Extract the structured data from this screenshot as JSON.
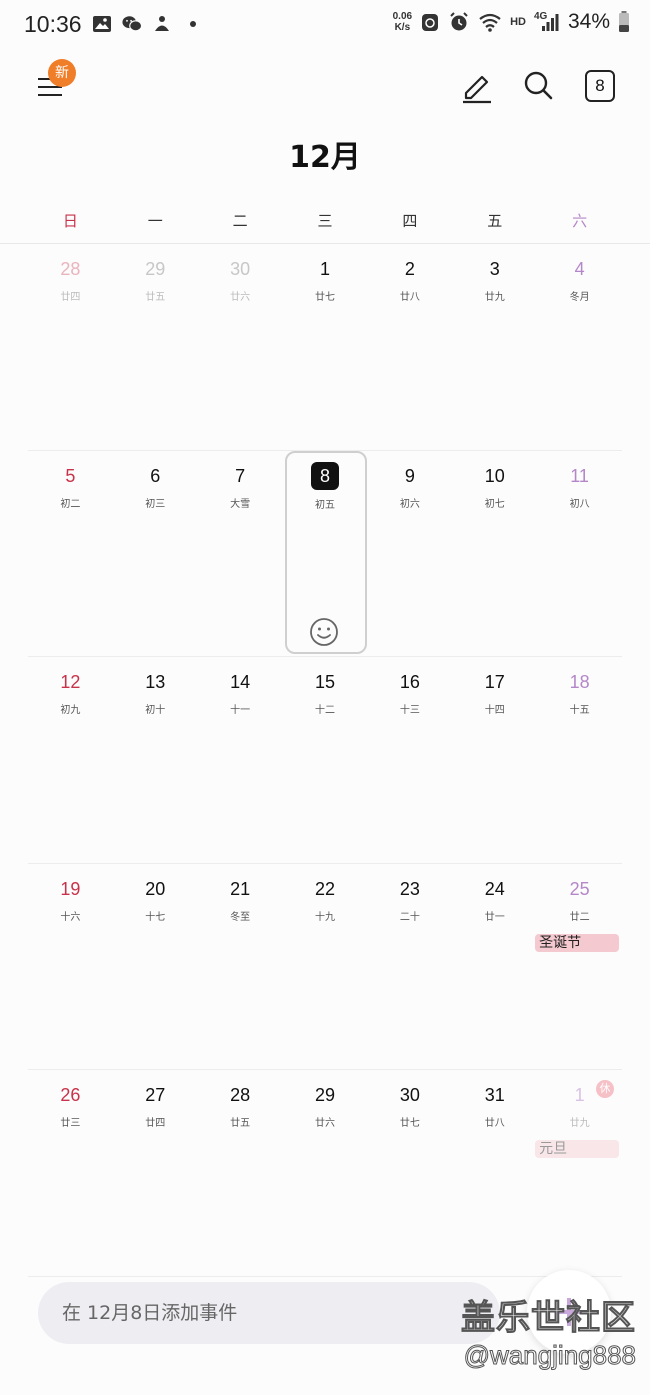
{
  "status_bar": {
    "time": "10:36",
    "net_speed_value": "0.06",
    "net_speed_unit": "K/s",
    "hd": "HD",
    "signal_type": "4G",
    "battery": "34%"
  },
  "toolbar": {
    "new_badge": "新",
    "today_number": "8",
    "icons": [
      "menu-icon",
      "pen-icon",
      "search-icon",
      "today-icon"
    ]
  },
  "month_title": "12月",
  "weekdays": [
    "日",
    "一",
    "二",
    "三",
    "四",
    "五",
    "六"
  ],
  "weeks": [
    [
      {
        "day": "28",
        "lunar": "廿四",
        "other": true
      },
      {
        "day": "29",
        "lunar": "廿五",
        "other": true
      },
      {
        "day": "30",
        "lunar": "廿六",
        "other": true
      },
      {
        "day": "1",
        "lunar": "廿七"
      },
      {
        "day": "2",
        "lunar": "廿八"
      },
      {
        "day": "3",
        "lunar": "廿九"
      },
      {
        "day": "4",
        "lunar": "冬月"
      }
    ],
    [
      {
        "day": "5",
        "lunar": "初二"
      },
      {
        "day": "6",
        "lunar": "初三"
      },
      {
        "day": "7",
        "lunar": "大雪"
      },
      {
        "day": "8",
        "lunar": "初五",
        "today": true
      },
      {
        "day": "9",
        "lunar": "初六"
      },
      {
        "day": "10",
        "lunar": "初七"
      },
      {
        "day": "11",
        "lunar": "初八"
      }
    ],
    [
      {
        "day": "12",
        "lunar": "初九"
      },
      {
        "day": "13",
        "lunar": "初十"
      },
      {
        "day": "14",
        "lunar": "十一"
      },
      {
        "day": "15",
        "lunar": "十二"
      },
      {
        "day": "16",
        "lunar": "十三"
      },
      {
        "day": "17",
        "lunar": "十四"
      },
      {
        "day": "18",
        "lunar": "十五"
      }
    ],
    [
      {
        "day": "19",
        "lunar": "十六"
      },
      {
        "day": "20",
        "lunar": "十七"
      },
      {
        "day": "21",
        "lunar": "冬至"
      },
      {
        "day": "22",
        "lunar": "十九"
      },
      {
        "day": "23",
        "lunar": "二十"
      },
      {
        "day": "24",
        "lunar": "廿一"
      },
      {
        "day": "25",
        "lunar": "廿二",
        "event": "圣诞节",
        "event_style": "xmas"
      }
    ],
    [
      {
        "day": "26",
        "lunar": "廿三"
      },
      {
        "day": "27",
        "lunar": "廿四"
      },
      {
        "day": "28",
        "lunar": "廿五"
      },
      {
        "day": "29",
        "lunar": "廿六"
      },
      {
        "day": "30",
        "lunar": "廿七"
      },
      {
        "day": "31",
        "lunar": "廿八"
      },
      {
        "day": "1",
        "lunar": "廿九",
        "other": true,
        "event": "元旦",
        "event_style": "newyear",
        "badge": "休"
      }
    ]
  ],
  "add_event_placeholder": "在 12月8日添加事件",
  "watermark": {
    "line1": "盖乐世社区",
    "line2": "@wangjing888"
  },
  "colors": {
    "sunday": "#c8324a",
    "saturday": "#b487c9",
    "badge": "#f07d27",
    "event_xmas": "#f4c9d0"
  }
}
